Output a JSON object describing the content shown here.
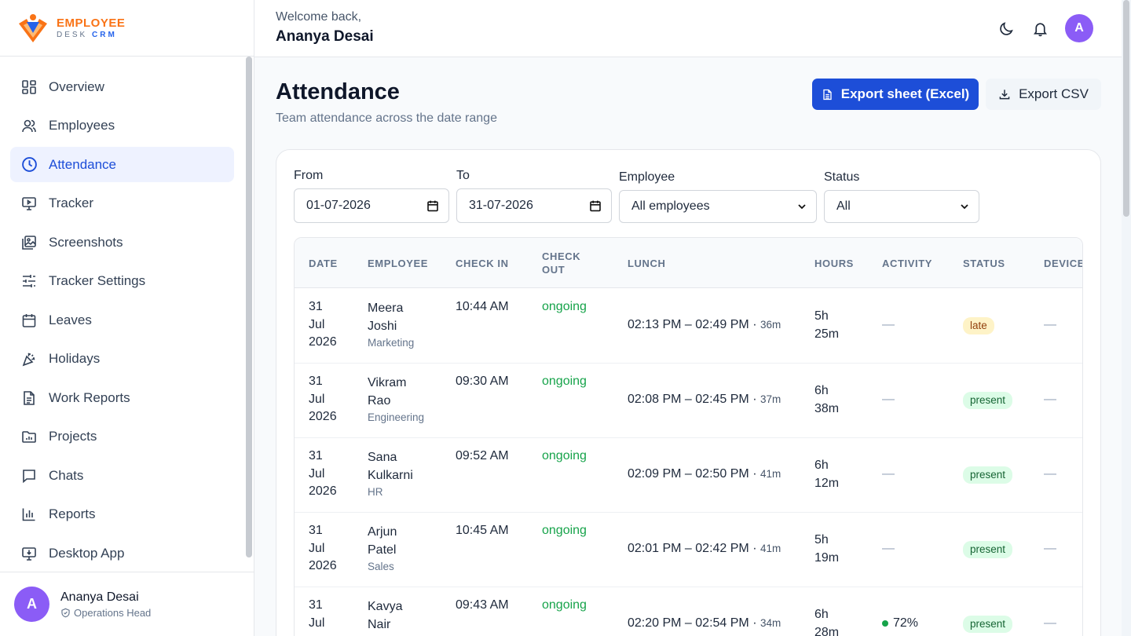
{
  "brand": {
    "line1": "EMPLOYEE",
    "line2a": "DESK",
    "line2b": "CRM"
  },
  "sidebar": {
    "items": [
      {
        "label": "Overview",
        "icon": "overview-icon"
      },
      {
        "label": "Employees",
        "icon": "users-icon"
      },
      {
        "label": "Attendance",
        "icon": "clock-icon",
        "active": true
      },
      {
        "label": "Tracker",
        "icon": "monitor-icon"
      },
      {
        "label": "Screenshots",
        "icon": "images-icon"
      },
      {
        "label": "Tracker Settings",
        "icon": "sliders-icon"
      },
      {
        "label": "Leaves",
        "icon": "calendar-icon"
      },
      {
        "label": "Holidays",
        "icon": "party-icon"
      },
      {
        "label": "Work Reports",
        "icon": "document-icon"
      },
      {
        "label": "Projects",
        "icon": "folder-chart-icon"
      },
      {
        "label": "Chats",
        "icon": "chat-icon"
      },
      {
        "label": "Reports",
        "icon": "bar-chart-icon"
      },
      {
        "label": "Desktop App",
        "icon": "desktop-download-icon"
      }
    ],
    "user": {
      "initial": "A",
      "name": "Ananya Desai",
      "role": "Operations Head"
    }
  },
  "header": {
    "welcome": "Welcome back,",
    "name": "Ananya Desai",
    "avatar_initial": "A"
  },
  "page": {
    "title": "Attendance",
    "subtitle": "Team attendance across the date range",
    "export_excel": "Export sheet (Excel)",
    "export_csv": "Export CSV"
  },
  "filters": {
    "from_label": "From",
    "from_value": "01-07-2026",
    "to_label": "To",
    "to_value": "31-07-2026",
    "employee_label": "Employee",
    "employee_value": "All employees",
    "status_label": "Status",
    "status_value": "All"
  },
  "table": {
    "headers": {
      "date": "DATE",
      "employee": "EMPLOYEE",
      "check_in": "CHECK IN",
      "check_out_1": "CHECK",
      "check_out_2": "OUT",
      "lunch": "LUNCH",
      "hours": "HOURS",
      "activity": "ACTIVITY",
      "status": "STATUS",
      "device": "DEVICE"
    },
    "rows": [
      {
        "d1": "31",
        "d2": "Jul",
        "d3": "2026",
        "first": "Meera",
        "last": "Joshi",
        "dept": "Marketing",
        "check_in": "10:44 AM",
        "check_out": "ongoing",
        "lunch": "02:13 PM – 02:49 PM · ",
        "lunch_dur": "36m",
        "hours1": "5h",
        "hours2": "25m",
        "activity": "—",
        "status": "late",
        "device": "—"
      },
      {
        "d1": "31",
        "d2": "Jul",
        "d3": "2026",
        "first": "Vikram",
        "last": "Rao",
        "dept": "Engineering",
        "check_in": "09:30 AM",
        "check_out": "ongoing",
        "lunch": "02:08 PM – 02:45 PM · ",
        "lunch_dur": "37m",
        "hours1": "6h",
        "hours2": "38m",
        "activity": "—",
        "status": "present",
        "device": "—"
      },
      {
        "d1": "31",
        "d2": "Jul",
        "d3": "2026",
        "first": "Sana",
        "last": "Kulkarni",
        "dept": "HR",
        "check_in": "09:52 AM",
        "check_out": "ongoing",
        "lunch": "02:09 PM – 02:50 PM · ",
        "lunch_dur": "41m",
        "hours1": "6h",
        "hours2": "12m",
        "activity": "—",
        "status": "present",
        "device": "—"
      },
      {
        "d1": "31",
        "d2": "Jul",
        "d3": "2026",
        "first": "Arjun",
        "last": "Patel",
        "dept": "Sales",
        "check_in": "10:45 AM",
        "check_out": "ongoing",
        "lunch": "02:01 PM – 02:42 PM · ",
        "lunch_dur": "41m",
        "hours1": "5h",
        "hours2": "19m",
        "activity": "—",
        "status": "present",
        "device": "—"
      },
      {
        "d1": "31",
        "d2": "Jul",
        "d3": "",
        "first": "Kavya",
        "last": "Nair",
        "dept": "",
        "check_in": "09:43 AM",
        "check_out": "ongoing",
        "lunch": "02:20 PM – 02:54 PM · ",
        "lunch_dur": "34m",
        "hours1": "6h",
        "hours2": "28m",
        "activity": "72%",
        "status": "present",
        "device": "—"
      }
    ]
  },
  "colors": {
    "accent": "#1d4ed8",
    "avatar": "#8b5cf6",
    "success": "#16a34a",
    "late_bg": "#fef3c7",
    "present_bg": "#dcfce7"
  }
}
